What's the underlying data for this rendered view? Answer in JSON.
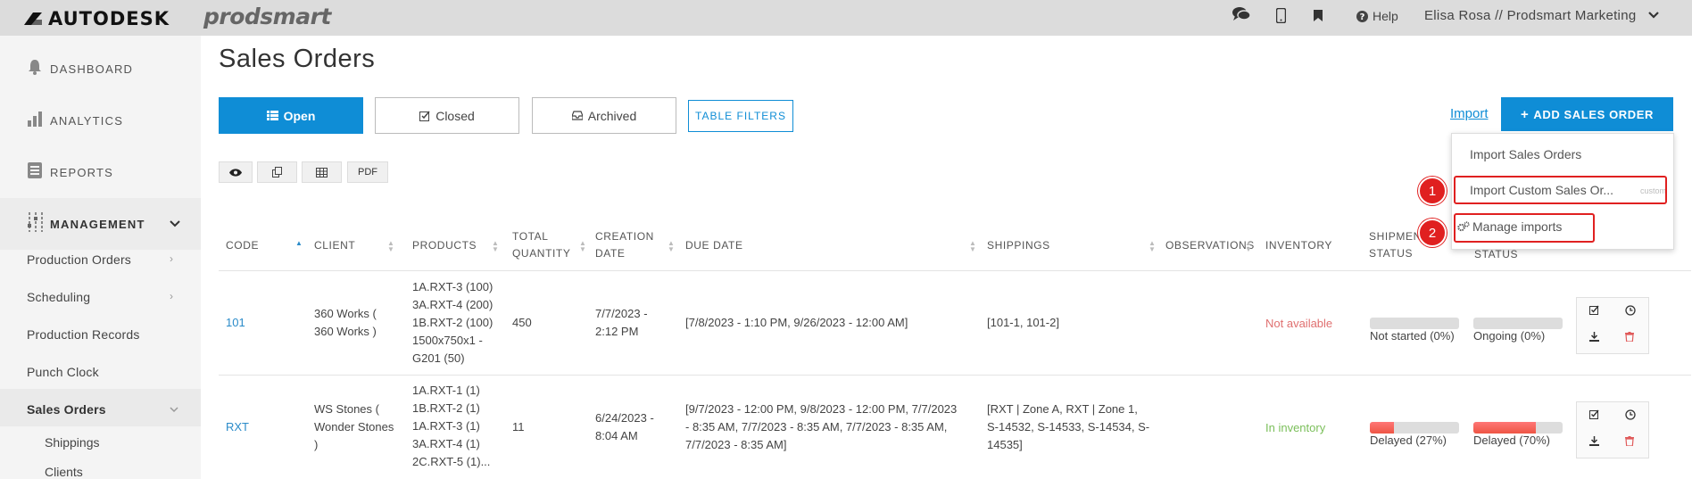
{
  "topbar": {
    "brand": "AUTODESK",
    "product": "prodsmart",
    "help_label": "Help",
    "user_label": "Elisa Rosa // Prodsmart Marketing",
    "icons": [
      "chat-icon",
      "mobile-icon",
      "bookmark-icon",
      "help-icon",
      "chevron-down-icon"
    ]
  },
  "sidebar": {
    "main": [
      {
        "label": "DASHBOARD",
        "icon": "bell-icon"
      },
      {
        "label": "ANALYTICS",
        "icon": "bar-chart-icon"
      },
      {
        "label": "REPORTS",
        "icon": "document-icon"
      },
      {
        "label": "MANAGEMENT",
        "icon": "sliders-icon"
      }
    ],
    "sub": [
      {
        "label": "Production Orders"
      },
      {
        "label": "Scheduling"
      },
      {
        "label": "Production Records"
      },
      {
        "label": "Punch Clock"
      },
      {
        "label": "Sales Orders"
      }
    ],
    "sub2": [
      {
        "label": "Shippings"
      },
      {
        "label": "Clients"
      }
    ]
  },
  "page": {
    "title": "Sales Orders"
  },
  "filters": {
    "open": "Open",
    "closed": "Closed",
    "archived": "Archived",
    "table_filters": "TABLE FILTERS"
  },
  "actions": {
    "import": "Import",
    "add": "ADD SALES ORDER"
  },
  "tools": {
    "pdf": "PDF"
  },
  "dropdown": {
    "item1": "Import Sales Orders",
    "item2": "Import Custom Sales Or...",
    "item2_tag": "custom",
    "item3": "Manage imports"
  },
  "markers": {
    "m1": "1",
    "m2": "2"
  },
  "table": {
    "headers": {
      "code": "CODE",
      "client": "CLIENT",
      "products": "PRODUCTS",
      "total_quantity_1": "TOTAL",
      "total_quantity_2": "QUANTITY",
      "creation_date_1": "CREATION",
      "creation_date_2": "DATE",
      "due_date": "DUE DATE",
      "shippings": "SHIPPINGS",
      "observations": "OBSERVATIONS",
      "inventory": "INVENTORY",
      "shipment_status_1": "SHIPMEN",
      "shipment_status_2": "STATUS",
      "status_2": "STATUS"
    },
    "rows": [
      {
        "code": "101",
        "client_1": "360 Works (",
        "client_2": "360 Works )",
        "products": [
          "1A.RXT-3 (100)",
          "3A.RXT-4 (200)",
          "1B.RXT-2 (100)",
          "1500x750x1 -",
          "G201 (50)"
        ],
        "total": "450",
        "created_1": "7/7/2023 -",
        "created_2": "2:12 PM",
        "due": "[7/8/2023 - 1:10 PM, 9/26/2023 - 12:00 AM]",
        "shippings": "[101-1, 101-2]",
        "inventory": "Not available",
        "shipment_status": "Not started (0%)",
        "shipment_progress": 0,
        "status": "Ongoing (0%)",
        "status_progress": 0
      },
      {
        "code": "RXT",
        "client_1": "WS Stones (",
        "client_2": "Wonder Stones",
        "client_3": ")",
        "products": [
          "1A.RXT-1 (1)",
          "1B.RXT-2 (1)",
          "1A.RXT-3 (1)",
          "3A.RXT-4 (1)",
          "2C.RXT-5 (1)..."
        ],
        "total": "11",
        "created_1": "6/24/2023 -",
        "created_2": "8:04 AM",
        "due_1": "[9/7/2023 - 12:00 PM, 9/8/2023 - 12:00 PM, 7/7/2023",
        "due_2": "- 8:35 AM, 7/7/2023 - 8:35 AM, 7/7/2023 - 8:35 AM,",
        "due_3": "7/7/2023 - 8:35 AM]",
        "ship_1": "[RXT | Zone A, RXT | Zone 1,",
        "ship_2": "S-14532, S-14533, S-14534, S-",
        "ship_3": "14535]",
        "inventory": "In inventory",
        "shipment_status": "Delayed (27%)",
        "shipment_progress": 27,
        "status": "Delayed (70%)",
        "status_progress": 70
      }
    ]
  }
}
